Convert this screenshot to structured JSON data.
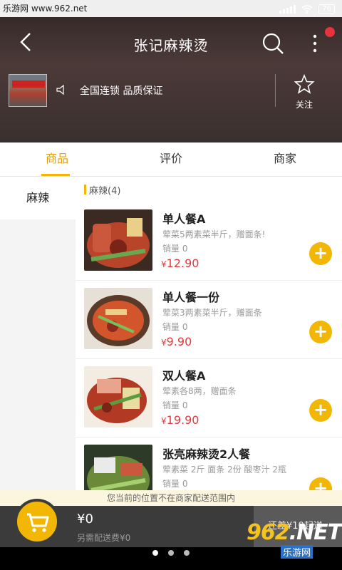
{
  "watermark": "乐游网 www.962.net",
  "status": {
    "battery": "76"
  },
  "header": {
    "title": "张记麻辣烫"
  },
  "store": {
    "slogan": "全国连锁 品质保证",
    "follow_label": "关注"
  },
  "tabs": [
    {
      "label": "商品",
      "active": true
    },
    {
      "label": "评价",
      "active": false
    },
    {
      "label": "商家",
      "active": false
    }
  ],
  "sidebar": {
    "items": [
      {
        "label": "麻辣"
      }
    ]
  },
  "category": {
    "title": "麻辣(4)"
  },
  "products": [
    {
      "name": "单人餐A",
      "desc": "荤菜5两素菜半斤，赠面条!",
      "sales": "销量 0",
      "currency": "¥",
      "price": "12.90"
    },
    {
      "name": "单人餐一份",
      "desc": "荤菜3两素菜半斤，赠面条",
      "sales": "销量 0",
      "currency": "¥",
      "price": "9.90"
    },
    {
      "name": "双人餐A",
      "desc": "荤素各8两，赠面条",
      "sales": "销量 0",
      "currency": "¥",
      "price": "19.90"
    },
    {
      "name": "张亮麻辣烫2人餐",
      "desc": "荤素菜 2斤 面条 2份 酸枣汁 2瓶",
      "sales": "销量 0",
      "currency": "",
      "price": ""
    }
  ],
  "notice": "您当前的位置不在商家配送范围内",
  "cart": {
    "total": "¥0",
    "fee": "另需配送费¥0",
    "checkout": "还差¥10起送"
  },
  "branding": {
    "number": "962",
    "suffix": ".NET",
    "site": "乐游网"
  },
  "colors": {
    "accent": "#f2b705",
    "price": "#e4393c",
    "badge": "#e8323c"
  }
}
